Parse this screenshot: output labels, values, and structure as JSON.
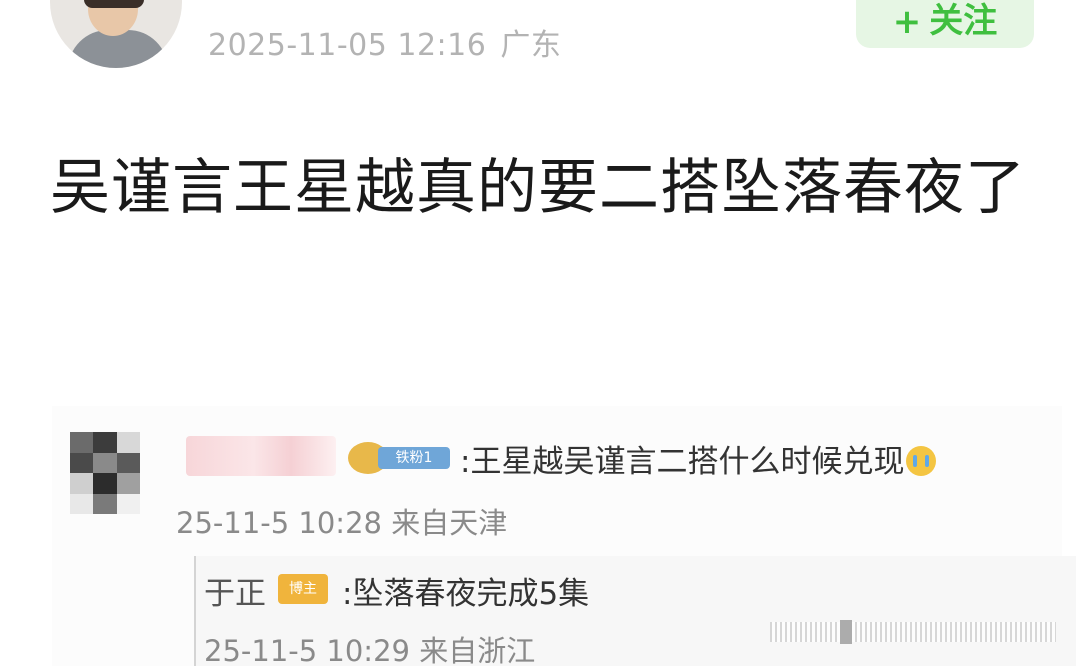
{
  "post": {
    "timestamp": "2025-11-05 12:16",
    "location": "广东",
    "follow_plus": "+",
    "follow_label": "关注",
    "title": "吴谨言王星越真的要二搭坠落春夜了"
  },
  "comment": {
    "badge_text": "铁粉1",
    "text": ":王星越吴谨言二搭什么时候兑现",
    "time": "25-11-5 10:28 来自天津",
    "emoji_icon": "crying-face-icon",
    "reply": {
      "author": "于正",
      "badge_text": "博主",
      "text": ":坠落春夜完成5集",
      "time": "25-11-5 10:29 来自浙江"
    }
  },
  "colors": {
    "follow_bg": "#e6f6e4",
    "follow_text": "#3fbf3f",
    "meta_text": "#b3b3b3",
    "title_text": "#1a1a1a"
  }
}
